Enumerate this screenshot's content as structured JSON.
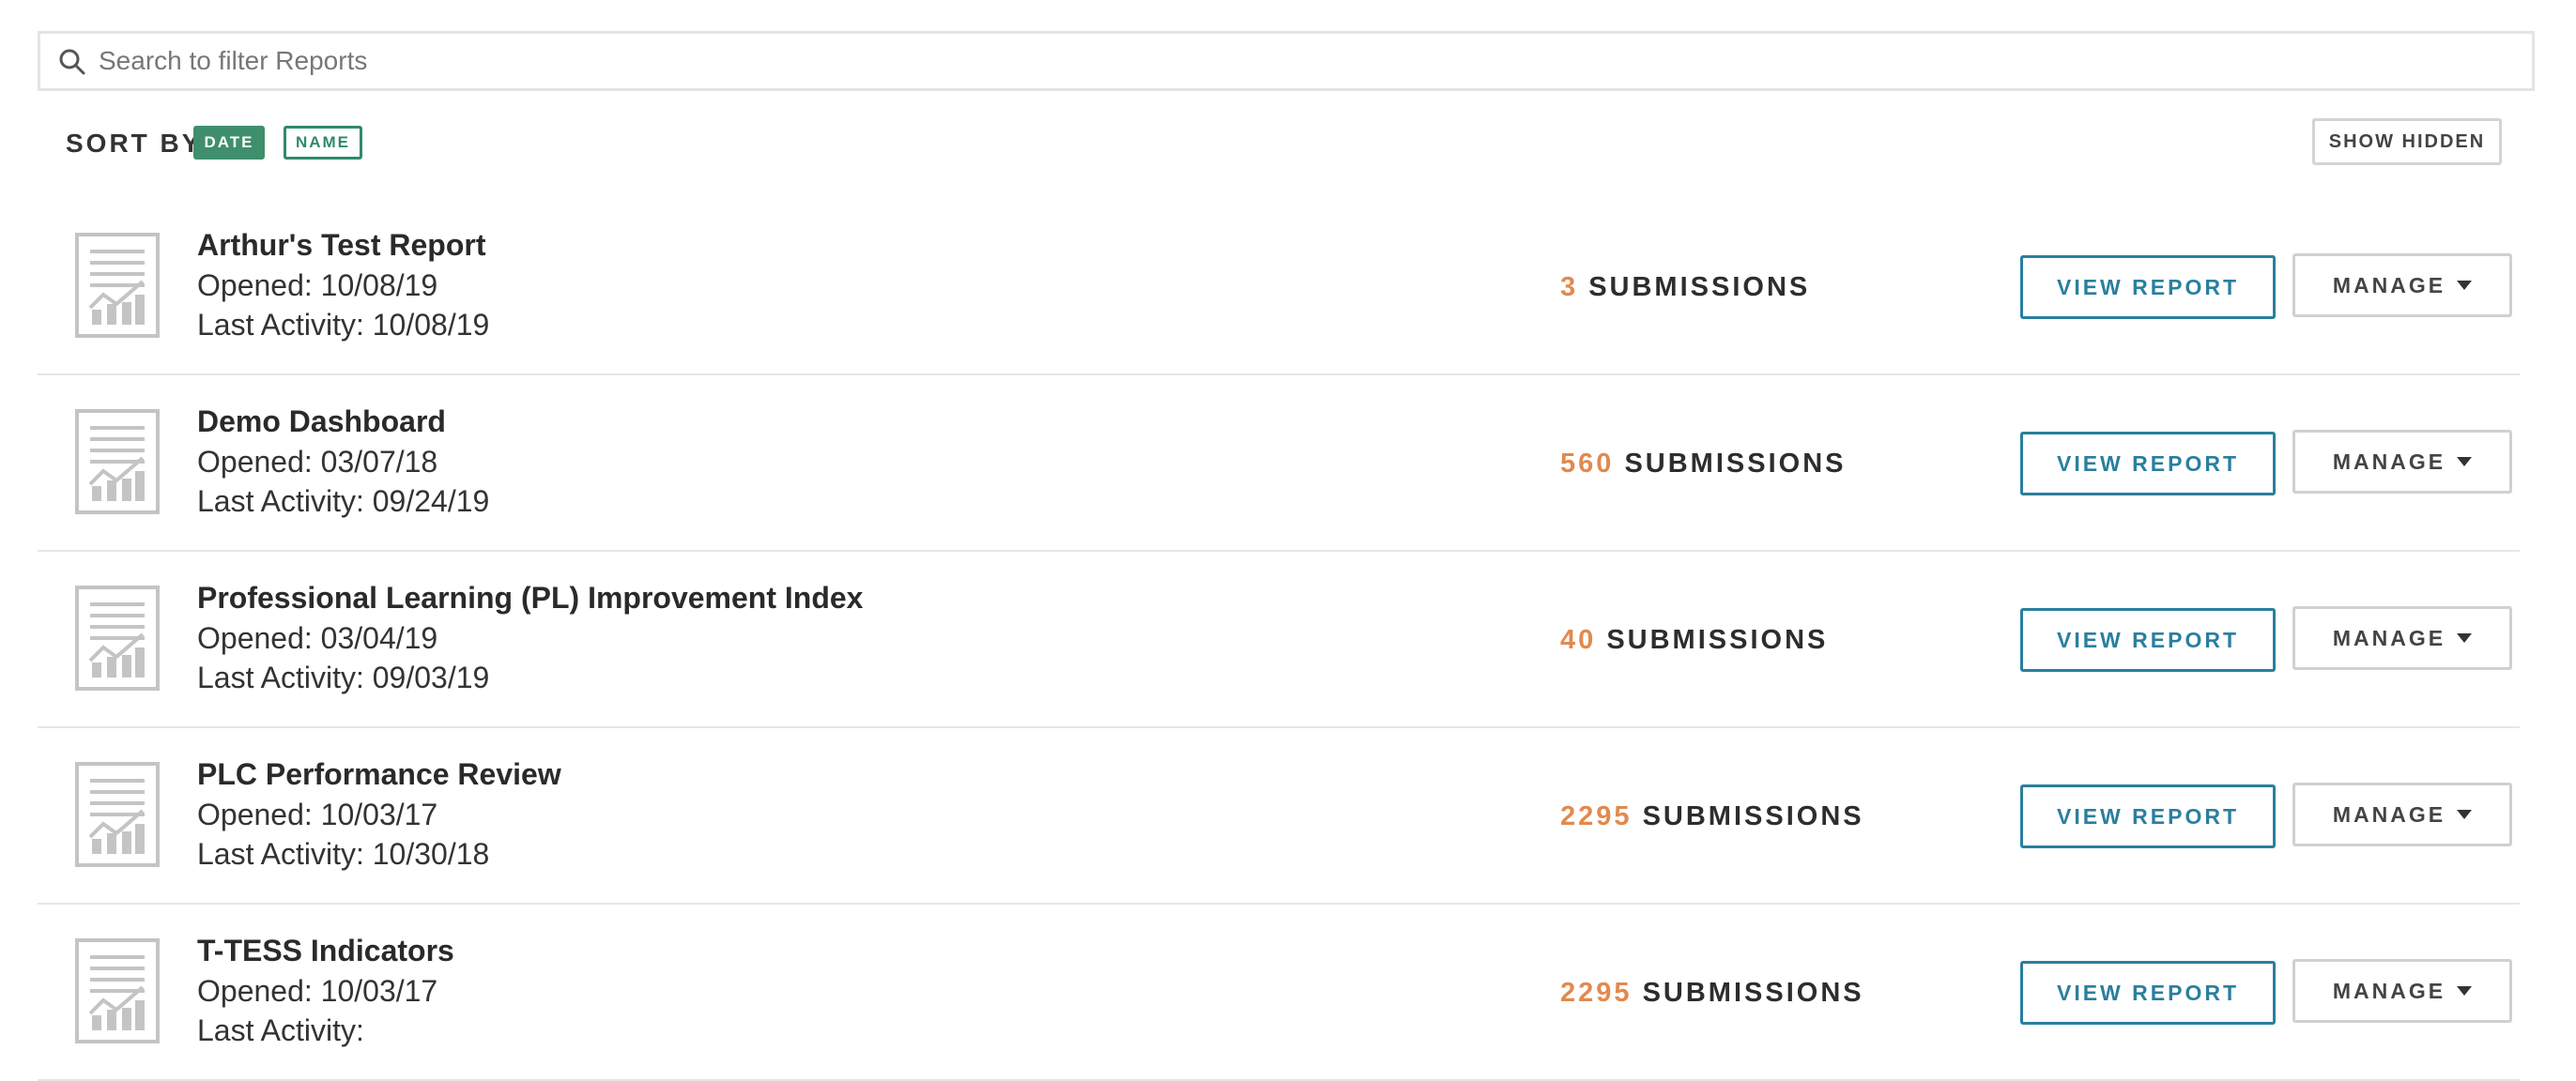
{
  "search": {
    "placeholder": "Search to filter Reports",
    "value": ""
  },
  "sort": {
    "label": "SORT BY",
    "options": [
      {
        "label": "DATE",
        "active": true
      },
      {
        "label": "NAME",
        "active": false
      }
    ]
  },
  "show_hidden_label": "SHOW HIDDEN",
  "colors": {
    "accent_green": "#3f8f6c",
    "accent_blue": "#2a7f9e",
    "count_orange": "#e2894f"
  },
  "reports": [
    {
      "title": "Arthur's Test Report",
      "opened": "Opened: 10/08/19",
      "last_activity": "Last Activity: 10/08/19",
      "count": "3",
      "submissions_label": "SUBMISSIONS",
      "view_label": "VIEW REPORT",
      "manage_label": "MANAGE"
    },
    {
      "title": "Demo Dashboard",
      "opened": "Opened: 03/07/18",
      "last_activity": "Last Activity: 09/24/19",
      "count": "560",
      "submissions_label": "SUBMISSIONS",
      "view_label": "VIEW REPORT",
      "manage_label": "MANAGE"
    },
    {
      "title": "Professional Learning (PL) Improvement Index",
      "opened": "Opened: 03/04/19",
      "last_activity": "Last Activity: 09/03/19",
      "count": "40",
      "submissions_label": "SUBMISSIONS",
      "view_label": "VIEW REPORT",
      "manage_label": "MANAGE"
    },
    {
      "title": "PLC Performance Review",
      "opened": "Opened: 10/03/17",
      "last_activity": "Last Activity: 10/30/18",
      "count": "2295",
      "submissions_label": "SUBMISSIONS",
      "view_label": "VIEW REPORT",
      "manage_label": "MANAGE"
    },
    {
      "title": "T-TESS Indicators",
      "opened": "Opened: 10/03/17",
      "last_activity": "Last Activity:",
      "count": "2295",
      "submissions_label": "SUBMISSIONS",
      "view_label": "VIEW REPORT",
      "manage_label": "MANAGE"
    }
  ]
}
